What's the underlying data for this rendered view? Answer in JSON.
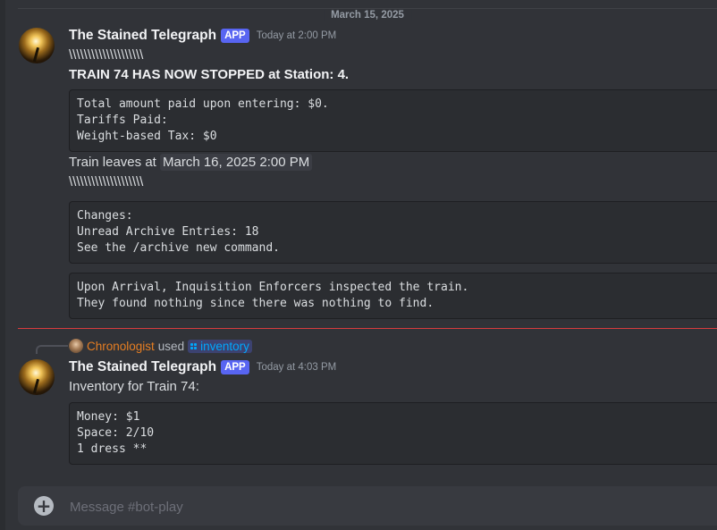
{
  "date_divider": "March 15, 2025",
  "messages": [
    {
      "author": "The Stained Telegraph",
      "tag": "APP",
      "timestamp": "Today at 2:00 PM",
      "separator_top": "\\\\\\\\\\\\\\\\\\\\\\\\\\\\\\\\\\\\\\\\",
      "headline": "TRAIN 74 HAS NOW STOPPED at Station: 4.",
      "code1": [
        "Total amount paid upon entering: $0.",
        "Tariffs Paid:",
        "Weight-based Tax: $0"
      ],
      "leaves_prefix": "Train leaves at ",
      "leaves_time": "March 16, 2025 2:00 PM",
      "separator_bottom": "\\\\\\\\\\\\\\\\\\\\\\\\\\\\\\\\\\\\\\\\",
      "code2": [
        "Changes:",
        "Unread Archive Entries: 18",
        "See the /archive new command."
      ],
      "code3": [
        "Upon Arrival, Inquisition Enforcers inspected the train.",
        "They found nothing since there was nothing to find."
      ]
    },
    {
      "reply_user": "Chronologist",
      "reply_used": "used",
      "reply_command": "inventory",
      "author": "The Stained Telegraph",
      "tag": "APP",
      "timestamp": "Today at 4:03 PM",
      "text": "Inventory for Train 74:",
      "code": [
        "Money: $1",
        "Space: 2/10",
        "1 dress **"
      ]
    }
  ],
  "composer": {
    "placeholder": "Message #bot-play",
    "plus_icon": "plus-circle-icon"
  }
}
